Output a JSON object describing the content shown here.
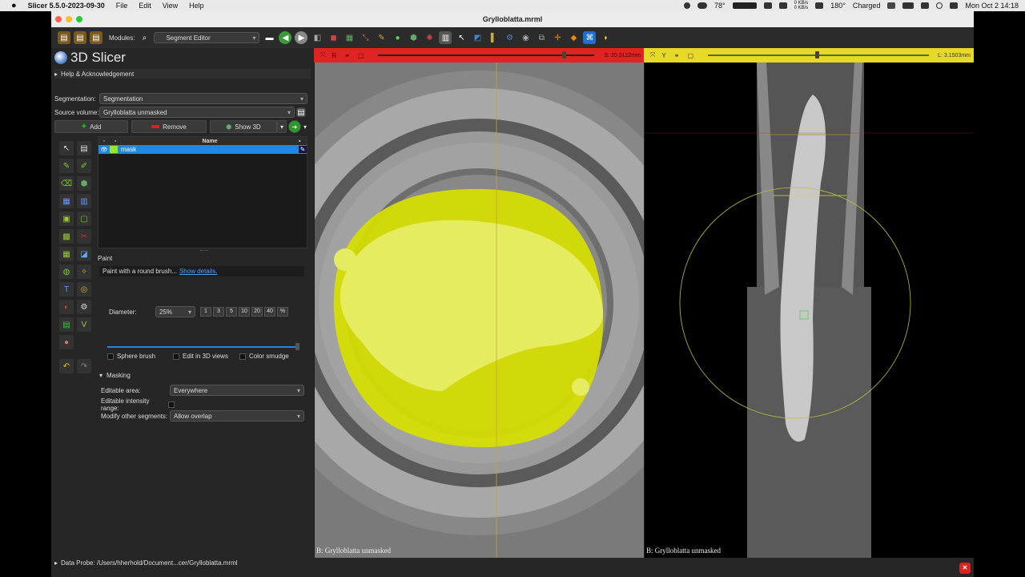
{
  "menubar": {
    "apple_icon": "apple-icon",
    "app_name": "Slicer 5.5.0-2023-09-30",
    "menus": [
      "File",
      "Edit",
      "View",
      "Help"
    ],
    "weather": "78°",
    "net_up": "0 KB/s",
    "net_down": "0 KB/s",
    "heading": "180°",
    "battery": "Charged",
    "datetime": "Mon Oct 2  14:18"
  },
  "window": {
    "title": "Grylloblatta.mrml"
  },
  "toolbar": {
    "modules_label": "Modules:",
    "module_selected": "Segment Editor"
  },
  "app": {
    "logo_text": "3D Slicer",
    "help_section": "Help & Acknowledgement"
  },
  "segment_editor": {
    "segmentation_label": "Segmentation:",
    "segmentation_value": "Segmentation",
    "source_label": "Source volume:",
    "source_value": "Grylloblatta unmasked",
    "add_label": "Add",
    "remove_label": "Remove",
    "show3d_label": "Show 3D",
    "table_header_name": "Name",
    "segments": [
      {
        "name": "mask",
        "color": "#9ee32a"
      }
    ],
    "effect_name": "Paint",
    "effect_description": "Paint with a round brush...",
    "show_details": "Show details.",
    "diameter_label": "Diameter:",
    "diameter_value": "25%",
    "presets": [
      "1",
      "3",
      "5",
      "10",
      "20",
      "40",
      "%"
    ],
    "sphere_brush": "Sphere brush",
    "edit_3d": "Edit in 3D views",
    "color_smudge": "Color smudge",
    "masking_label": "Masking",
    "editable_area_label": "Editable area:",
    "editable_area_value": "Everywhere",
    "editable_intensity_label": "Editable intensity range:",
    "modify_other_label": "Modify other segments:",
    "modify_other_value": "Allow overlap"
  },
  "views": {
    "red": {
      "letter": "R",
      "offset": "S: 20.3122mm",
      "label": "B: Grylloblatta unmasked",
      "bar_color": "#e02424"
    },
    "yellow": {
      "letter": "Y",
      "offset": "L: 3.1503mm",
      "label": "B: Grylloblatta unmasked",
      "bar_color": "#e8d82a"
    }
  },
  "status": {
    "data_probe": "Data Probe: /Users/hherhold/Document...cer/Grylloblatta.mrml"
  },
  "colors": {
    "segment_yellow": "#d8e000",
    "accent_blue": "#1e88e5"
  }
}
